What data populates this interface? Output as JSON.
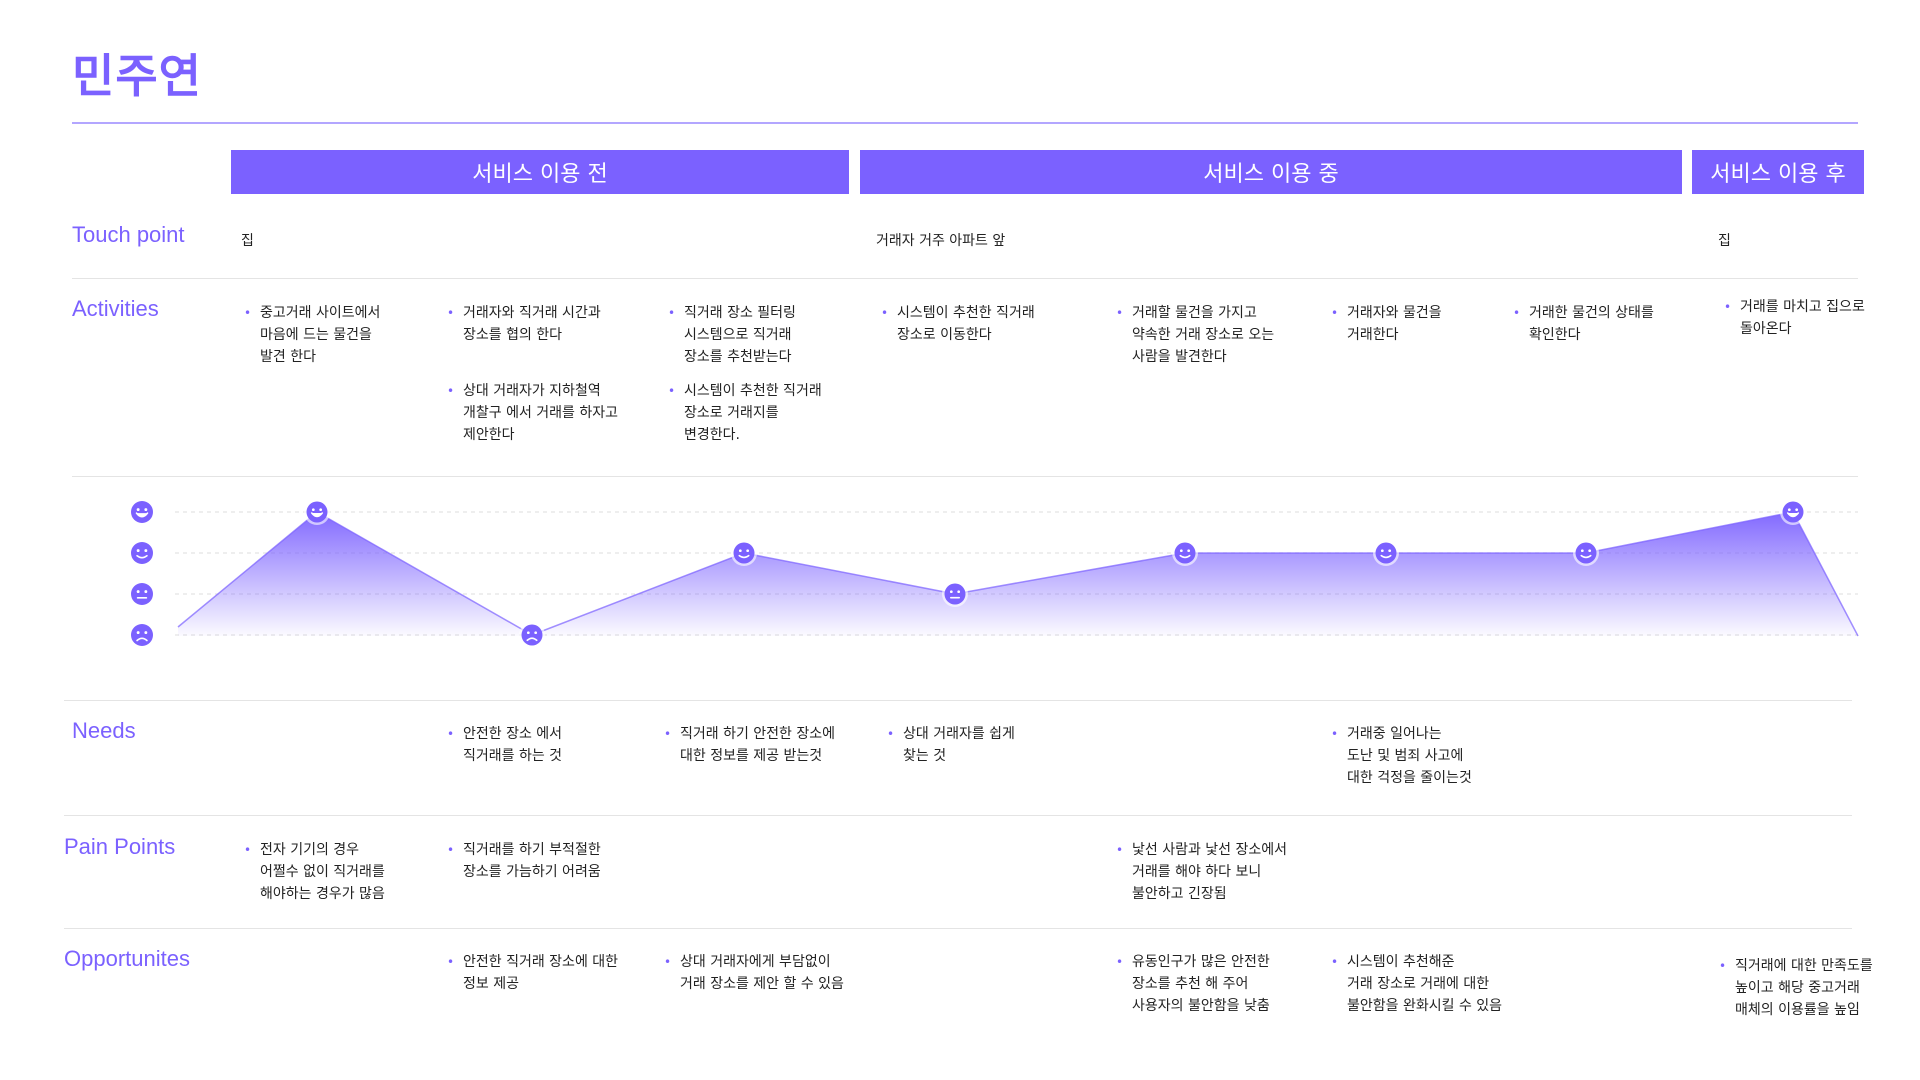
{
  "title": "민주연",
  "phases": [
    "서비스 이용 전",
    "서비스 이용 중",
    "서비스 이용 후"
  ],
  "rows": {
    "touch": "Touch point",
    "activities": "Activities",
    "needs": "Needs",
    "pain": "Pain Points",
    "opp": "Opportunites"
  },
  "touchpoints": [
    "집",
    "거래자 거주 아파트 앞",
    "집"
  ],
  "activities": [
    "중고거래 사이트에서\n마음에 드는 물건을\n발견 한다",
    "거래자와 직거래 시간과\n장소를 협의 한다",
    "상대 거래자가 지하철역\n개찰구 에서 거래를 하자고\n제안한다",
    "직거래 장소 필터링\n시스템으로 직거래\n장소를 추천받는다",
    "시스템이 추천한 직거래\n장소로 거래지를\n변경한다.",
    "시스템이 추천한 직거래\n장소로 이동한다",
    "거래할 물건을 가지고\n약속한 거래 장소로 오는\n사람을 발견한다",
    "거래자와 물건을\n거래한다",
    "거래한 물건의 상태를\n확인한다",
    "거래를 마치고 집으로\n돌아온다"
  ],
  "needs": [
    "안전한 장소 에서\n직거래를 하는 것",
    "직거래 하기 안전한 장소에\n대한 정보를 제공 받는것",
    "상대 거래자를 쉽게\n찾는 것",
    "거래중 일어나는\n도난 및 범죄 사고에\n대한 걱정을 줄이는것"
  ],
  "pain_points": [
    "전자 기기의 경우\n어쩔수 없이 직거래를\n해야하는 경우가 많음",
    "직거래를 하기 부적절한\n장소를 가늠하기 어려움",
    "낯선 사람과 낯선 장소에서\n거래를 해야 하다 보니\n 불안하고 긴장됨"
  ],
  "opportunities": [
    "안전한 직거래 장소에 대한\n정보 제공",
    "상대 거래자에게 부담없이\n거래 장소를 제안 할 수 있음",
    "유동인구가 많은 안전한\n장소를 추천 해 주어\n사용자의 불안함을 낮춤",
    "시스템이 추천해준\n 거래 장소로 거래에 대한\n 불안함을 완화시킬 수 있음",
    "직거래에 대한 만족도를\n 높이고 해당 중고거래\n 매체의 이용률을 높임"
  ],
  "colors": {
    "accent": "#7b61ff",
    "light": "#b3a6ff"
  },
  "chart_data": {
    "type": "area",
    "scale_levels": [
      "very-happy",
      "happy",
      "neutral",
      "sad"
    ],
    "levels": [
      4,
      1,
      3,
      2,
      3,
      3,
      3,
      4
    ]
  }
}
